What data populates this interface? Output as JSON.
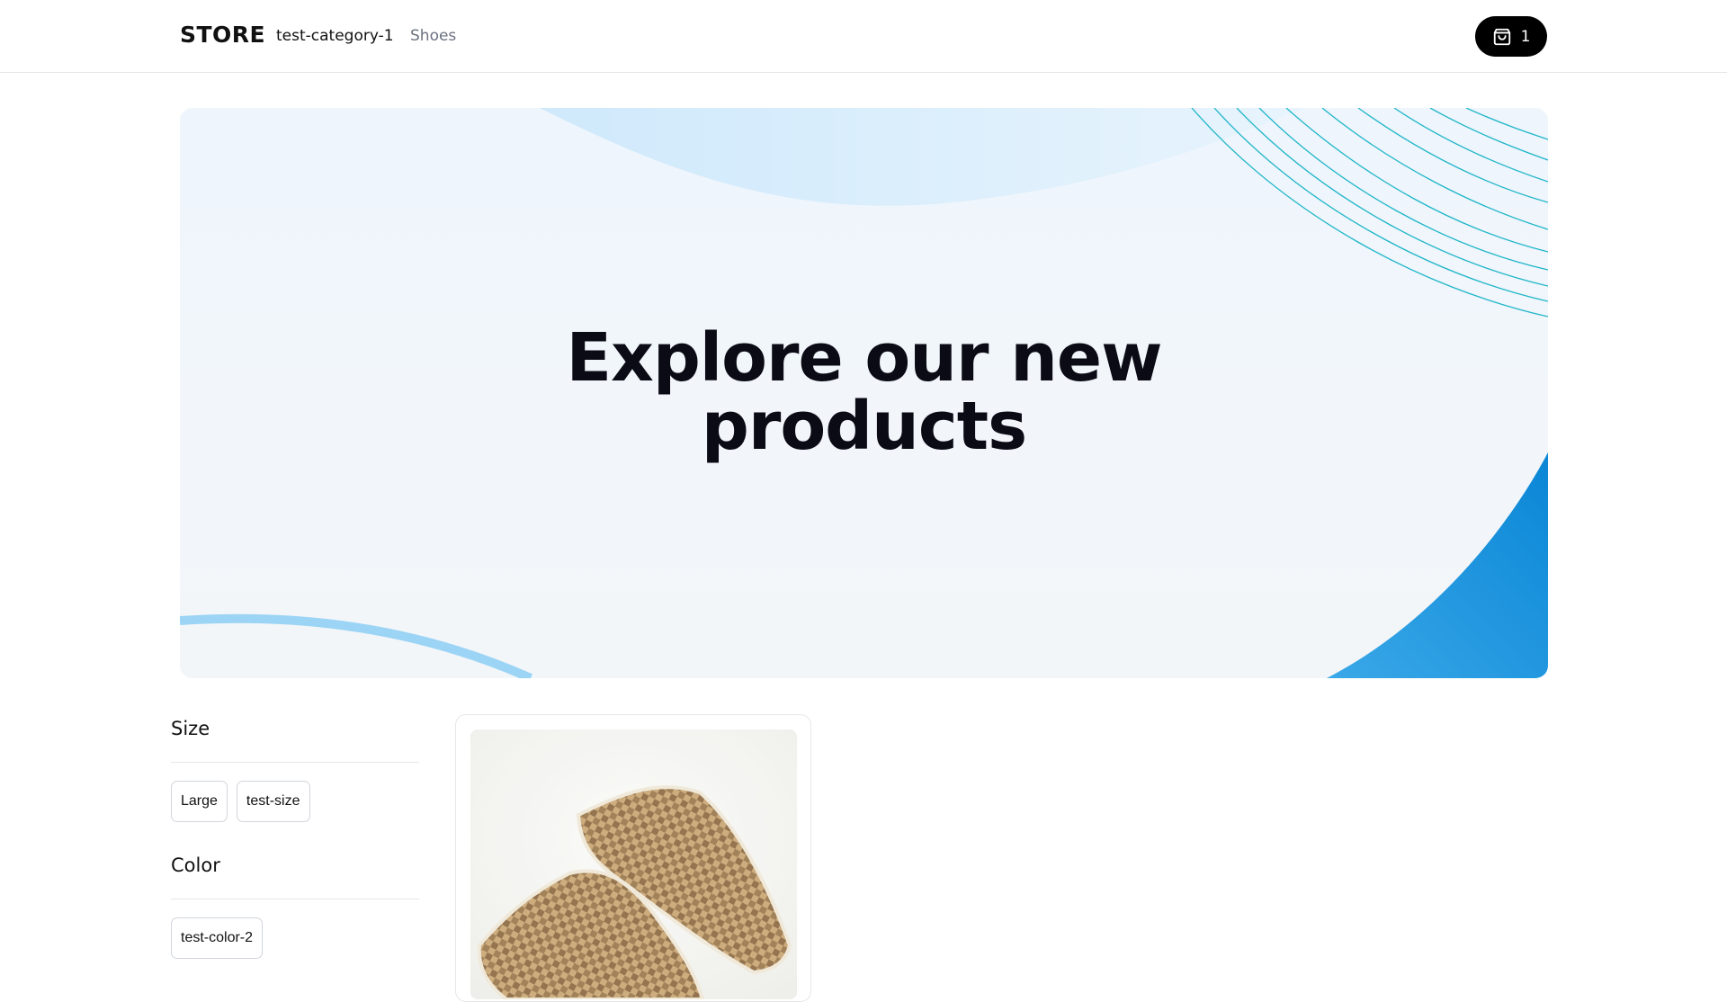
{
  "header": {
    "brand": "STORE",
    "nav": [
      "test-category-1",
      "Shoes"
    ],
    "cart": {
      "count": "1",
      "icon": "shopping-bag-icon"
    }
  },
  "hero": {
    "title_line1": "Explore our new",
    "title_line2": "products"
  },
  "filters": {
    "size": {
      "heading": "Size",
      "options": [
        "Large",
        "test-size"
      ]
    },
    "color": {
      "heading": "Color",
      "options": [
        "test-color-2"
      ]
    }
  },
  "colors": {
    "accent_blue": "#0b8fd8",
    "text_dark": "#0b0b16",
    "cart_bg": "#000000",
    "nav_muted": "#6b7280"
  }
}
